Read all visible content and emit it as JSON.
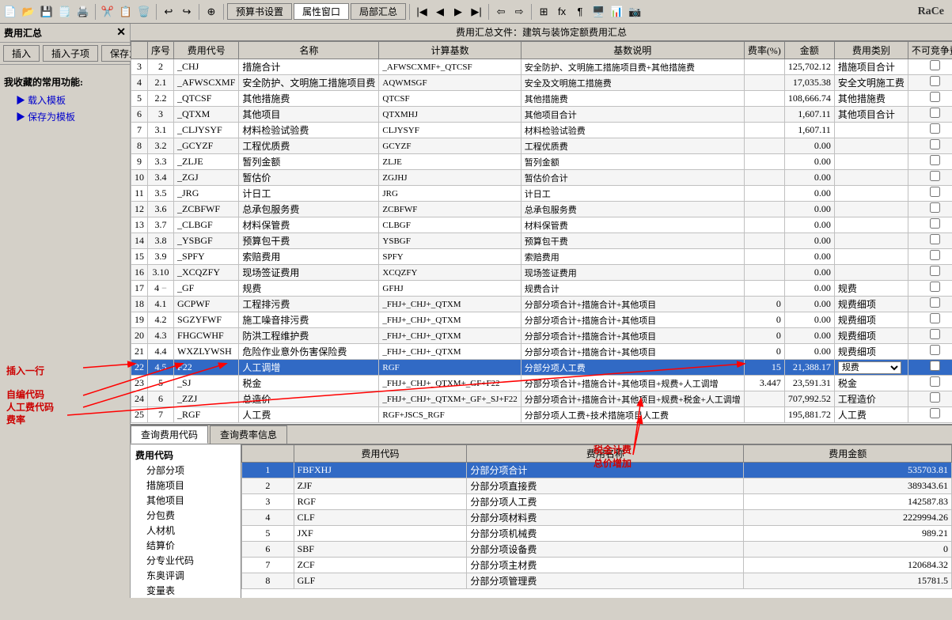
{
  "window": {
    "title": "费用汇总文件：建筑与装饰定额费用汇总"
  },
  "toolbar1": {
    "buttons": [
      "📁",
      "💾",
      "🗒️",
      "💾",
      "📋",
      "✂️",
      "📋",
      "🗑️",
      "↩️",
      "↪️",
      "📋"
    ]
  },
  "toolbar2": {
    "btn_budget": "预算书设置",
    "btn_props": "属性窗口",
    "btn_summary": "局部汇总"
  },
  "sub_toolbar": {
    "btn_insert": "插入",
    "btn_insert_child": "插入子项",
    "btn_save_template": "保存为模板",
    "btn_load_template": "载入模板"
  },
  "left_panel": {
    "title": "费用汇总",
    "section_title": "我收藏的常用功能:",
    "links": [
      "载入模板",
      "保存为模板"
    ]
  },
  "main_table": {
    "headers": [
      "序号",
      "费用代号",
      "名称",
      "计算基数",
      "基数说明",
      "费率(%)",
      "金额",
      "费用类别",
      "不可竞争费"
    ],
    "rows": [
      {
        "row": "3",
        "seq": "2",
        "expand": "",
        "code": "_CHJ",
        "name": "措施合计",
        "base": "_AFWSCXMF+_QTCSF",
        "desc": "安全防护、文明施工措施项目费+其他措施费",
        "rate": "",
        "amount": "125,702.12",
        "type": "措施项目合计",
        "check": false
      },
      {
        "row": "4",
        "seq": "2.1",
        "expand": "",
        "code": "_AFWSCXMF",
        "name": "安全防护、文明施工措施项目费",
        "base": "AQWMSGF",
        "desc": "安全及文明施工措施费",
        "rate": "",
        "amount": "17,035.38",
        "type": "安全文明施工费",
        "check": false
      },
      {
        "row": "5",
        "seq": "2.2",
        "expand": "",
        "code": "_QTCSF",
        "name": "其他措施费",
        "base": "QTCSF",
        "desc": "其他措施费",
        "rate": "",
        "amount": "108,666.74",
        "type": "其他措施费",
        "check": false
      },
      {
        "row": "6",
        "seq": "3",
        "expand": "",
        "code": "_QTXM",
        "name": "其他项目",
        "base": "QTXMHJ",
        "desc": "其他项目合计",
        "rate": "",
        "amount": "1,607.11",
        "type": "其他项目合计",
        "check": false
      },
      {
        "row": "7",
        "seq": "3.1",
        "expand": "",
        "code": "_CLJYSYF",
        "name": "材料检验试验费",
        "base": "CLJYSYF",
        "desc": "材料检验试验费",
        "rate": "",
        "amount": "1,607.11",
        "type": "",
        "check": false
      },
      {
        "row": "8",
        "seq": "3.2",
        "expand": "",
        "code": "_GCYZF",
        "name": "工程优质费",
        "base": "GCYZF",
        "desc": "工程优质费",
        "rate": "",
        "amount": "0.00",
        "type": "",
        "check": false
      },
      {
        "row": "9",
        "seq": "3.3",
        "expand": "",
        "code": "_ZLJE",
        "name": "暂列金额",
        "base": "ZLJE",
        "desc": "暂列金额",
        "rate": "",
        "amount": "0.00",
        "type": "",
        "check": false
      },
      {
        "row": "10",
        "seq": "3.4",
        "expand": "",
        "code": "_ZGJ",
        "name": "暂估价",
        "base": "ZGJHJ",
        "desc": "暂估价合计",
        "rate": "",
        "amount": "0.00",
        "type": "",
        "check": false
      },
      {
        "row": "11",
        "seq": "3.5",
        "expand": "",
        "code": "_JRG",
        "name": "计日工",
        "base": "JRG",
        "desc": "计日工",
        "rate": "",
        "amount": "0.00",
        "type": "",
        "check": false
      },
      {
        "row": "12",
        "seq": "3.6",
        "expand": "",
        "code": "_ZCBFWF",
        "name": "总承包服务费",
        "base": "ZCBFWF",
        "desc": "总承包服务费",
        "rate": "",
        "amount": "0.00",
        "type": "",
        "check": false
      },
      {
        "row": "13",
        "seq": "3.7",
        "expand": "",
        "code": "_CLBGF",
        "name": "材料保管费",
        "base": "CLBGF",
        "desc": "材料保管费",
        "rate": "",
        "amount": "0.00",
        "type": "",
        "check": false
      },
      {
        "row": "14",
        "seq": "3.8",
        "expand": "",
        "code": "_YSBGF",
        "name": "预算包干费",
        "base": "YSBGF",
        "desc": "预算包干费",
        "rate": "",
        "amount": "0.00",
        "type": "",
        "check": false
      },
      {
        "row": "15",
        "seq": "3.9",
        "expand": "",
        "code": "_SPFY",
        "name": "索赔费用",
        "base": "SPFY",
        "desc": "索赔费用",
        "rate": "",
        "amount": "0.00",
        "type": "",
        "check": false
      },
      {
        "row": "16",
        "seq": "3.10",
        "expand": "",
        "code": "_XCQZFY",
        "name": "现场签证费用",
        "base": "XCQZFY",
        "desc": "现场签证费用",
        "rate": "",
        "amount": "0.00",
        "type": "",
        "check": false
      },
      {
        "row": "17",
        "seq": "4",
        "expand": "−",
        "code": "_GF",
        "name": "规费",
        "base": "GFHJ",
        "desc": "规费合计",
        "rate": "",
        "amount": "0.00",
        "type": "规费",
        "check": false
      },
      {
        "row": "18",
        "seq": "4.1",
        "expand": "",
        "code": "GCPWF",
        "name": "工程排污费",
        "base": "_FHJ+_CHJ+_QTXM",
        "desc": "分部分项合计+措施合计+其他项目",
        "rate": "0",
        "amount": "0.00",
        "type": "规费细项",
        "check": false
      },
      {
        "row": "19",
        "seq": "4.2",
        "expand": "",
        "code": "SGZYFWF",
        "name": "施工噪音排污费",
        "base": "_FHJ+_CHJ+_QTXM",
        "desc": "分部分项合计+措施合计+其他项目",
        "rate": "0",
        "amount": "0.00",
        "type": "规费细项",
        "check": false
      },
      {
        "row": "20",
        "seq": "4.3",
        "expand": "",
        "code": "FHGCWHF",
        "name": "防洪工程维护费",
        "base": "_FHJ+_CHJ+_QTXM",
        "desc": "分部分项合计+措施合计+其他项目",
        "rate": "0",
        "amount": "0.00",
        "type": "规费细项",
        "check": false
      },
      {
        "row": "21",
        "seq": "4.4",
        "expand": "",
        "code": "WXZLYWSH",
        "name": "危险作业意外伤害保险费",
        "base": "_FHJ+_CHJ+_QTXM",
        "desc": "分部分项合计+措施合计+其他项目",
        "rate": "0",
        "amount": "0.00",
        "type": "规费细项",
        "check": false
      },
      {
        "row": "22",
        "seq": "4.5",
        "expand": "",
        "code": "F22",
        "name": "人工调增",
        "base": "RGF",
        "desc": "分部分项人工费",
        "rate": "15",
        "amount": "21,388.17",
        "type": "规费",
        "type_dropdown": true,
        "check": false,
        "selected": true
      },
      {
        "row": "23",
        "seq": "5",
        "expand": "",
        "code": "_SJ",
        "name": "税金",
        "base": "_FHJ+_CHJ+_QTXM+_GF+F22",
        "desc": "分部分项合计+措施合计+其他项目+规费+人工调增",
        "rate": "3.447",
        "amount": "23,591.31",
        "type": "税金",
        "check": false
      },
      {
        "row": "24",
        "seq": "6",
        "expand": "",
        "code": "_ZZJ",
        "name": "总造价",
        "base": "_FHJ+_CHJ+_QTXM+_GF+_SJ+F22",
        "desc": "分部分项合计+措施合计+其他项目+规费+税金+人工调增",
        "rate": "",
        "amount": "707,992.52",
        "type": "工程造价",
        "check": false
      },
      {
        "row": "25",
        "seq": "7",
        "expand": "",
        "code": "_RGF",
        "name": "人工费",
        "base": "RGF+JSCS_RGF",
        "desc": "分部分项人工费+技术措施项目人工费",
        "rate": "",
        "amount": "195,881.72",
        "type": "人工费",
        "check": false
      }
    ]
  },
  "bottom_tabs": {
    "tab1": "查询费用代码",
    "tab2": "查询费率信息"
  },
  "tree": {
    "root": "费用代码",
    "items": [
      {
        "label": "分部分项",
        "indent": 1
      },
      {
        "label": "措施项目",
        "indent": 1
      },
      {
        "label": "其他项目",
        "indent": 1
      },
      {
        "label": "分包费",
        "indent": 1
      },
      {
        "label": "人材机",
        "indent": 1
      },
      {
        "label": "结算价",
        "indent": 1
      },
      {
        "label": "分专业代码",
        "indent": 1
      },
      {
        "label": "东奥评调",
        "indent": 1
      },
      {
        "label": "变量表",
        "indent": 1
      }
    ]
  },
  "bottom_table": {
    "headers": [
      "",
      "费用代码",
      "费用名称",
      "费用金额"
    ],
    "rows": [
      {
        "num": "1",
        "code": "FBFXHJ",
        "name": "分部分项合计",
        "amount": "535703.81",
        "selected": true
      },
      {
        "num": "2",
        "code": "ZJF",
        "name": "分部分项直接费",
        "amount": "389343.61"
      },
      {
        "num": "3",
        "code": "RGF",
        "name": "分部分项人工费",
        "amount": "142587.83"
      },
      {
        "num": "4",
        "code": "CLF",
        "name": "分部分项材料费",
        "amount": "2229994.26"
      },
      {
        "num": "5",
        "code": "JXF",
        "name": "分部分项机械费",
        "amount": "989.21"
      },
      {
        "num": "6",
        "code": "SBF",
        "name": "分部分项设备费",
        "amount": "0"
      },
      {
        "num": "7",
        "code": "ZCF",
        "name": "分部分项主材费",
        "amount": "120684.32"
      },
      {
        "num": "8",
        "code": "GLF",
        "name": "分部分项管理费",
        "amount": "15781.5"
      }
    ]
  },
  "annotations": {
    "insert_row": "插入一行",
    "custom_code": "自编代码",
    "labor_code": "人工费代码",
    "rate": "费率",
    "tax_increase": "税金计费\n总价增加"
  }
}
